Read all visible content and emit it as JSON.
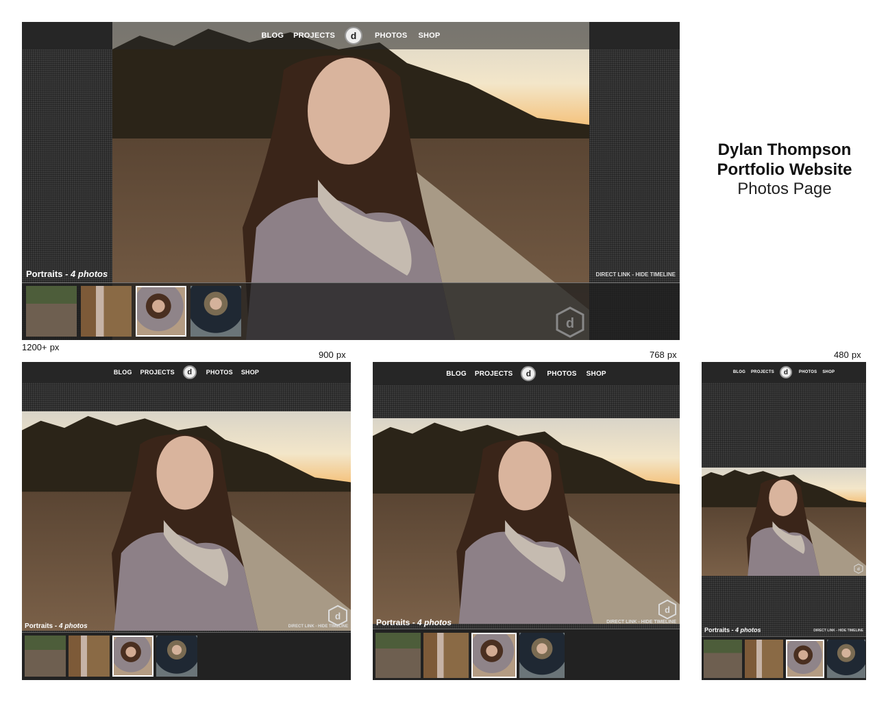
{
  "title": {
    "line1": "Dylan Thompson",
    "line2": "Portfolio Website",
    "line3": "Photos Page"
  },
  "nav": {
    "items": [
      "BLOG",
      "PROJECTS",
      "PHOTOS",
      "SHOP"
    ],
    "logo_glyph": "d"
  },
  "gallery": {
    "album": "Portraits",
    "count": "- 4 photos",
    "links": "DIRECT LINK - HIDE TIMELINE"
  },
  "breakpoints": {
    "desktop": "1200+",
    "tablet": "900",
    "small": "768",
    "mobile": "480",
    "unit": "px"
  },
  "icons": {
    "nav_logo": "d-monogram-circle-icon",
    "watermark": "d-monogram-hexagon-icon"
  },
  "colors": {
    "nav_bar": "#262626",
    "panel": "#3b3b3b",
    "strip": "#222222",
    "accent_text": "#ffffff"
  }
}
